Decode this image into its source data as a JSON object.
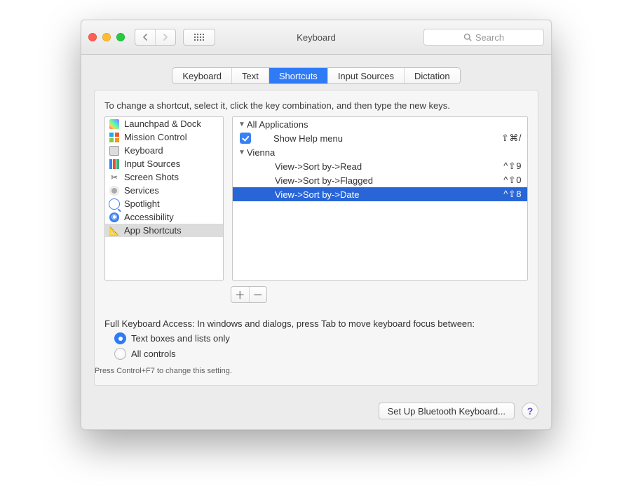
{
  "window": {
    "title": "Keyboard",
    "search_placeholder": "Search"
  },
  "tabs": [
    {
      "label": "Keyboard",
      "active": false
    },
    {
      "label": "Text",
      "active": false
    },
    {
      "label": "Shortcuts",
      "active": true
    },
    {
      "label": "Input Sources",
      "active": false
    },
    {
      "label": "Dictation",
      "active": false
    }
  ],
  "shortcuts": {
    "instruction": "To change a shortcut, select it, click the key combination, and then type the new keys.",
    "categories": [
      {
        "label": "Launchpad & Dock",
        "icon": "launchpad",
        "selected": false
      },
      {
        "label": "Mission Control",
        "icon": "mission-control",
        "selected": false
      },
      {
        "label": "Keyboard",
        "icon": "keyboard",
        "selected": false
      },
      {
        "label": "Input Sources",
        "icon": "input-sources",
        "selected": false
      },
      {
        "label": "Screen Shots",
        "icon": "screen-shots",
        "selected": false
      },
      {
        "label": "Services",
        "icon": "services",
        "selected": false
      },
      {
        "label": "Spotlight",
        "icon": "spotlight",
        "selected": false
      },
      {
        "label": "Accessibility",
        "icon": "accessibility",
        "selected": false
      },
      {
        "label": "App Shortcuts",
        "icon": "app-shortcuts",
        "selected": true
      }
    ],
    "tree": {
      "group_all_label": "All Applications",
      "all_items": [
        {
          "label": "Show Help menu",
          "keys": "⇧⌘/",
          "checked": true
        }
      ],
      "group_app_label": "Vienna",
      "app_items": [
        {
          "label": "View->Sort by->Read",
          "keys": "^⇧9",
          "selected": false
        },
        {
          "label": "View->Sort by->Flagged",
          "keys": "^⇧0",
          "selected": false
        },
        {
          "label": "View->Sort by->Date",
          "keys": "^⇧8",
          "selected": true
        }
      ]
    },
    "add_label": "＋",
    "remove_label": "－"
  },
  "fka": {
    "heading": "Full Keyboard Access: In windows and dialogs, press Tab to move keyboard focus between:",
    "option_textboxes": "Text boxes and lists only",
    "option_all": "All controls",
    "hint": "Press Control+F7 to change this setting."
  },
  "footer": {
    "bluetooth": "Set Up Bluetooth Keyboard...",
    "help": "?"
  }
}
